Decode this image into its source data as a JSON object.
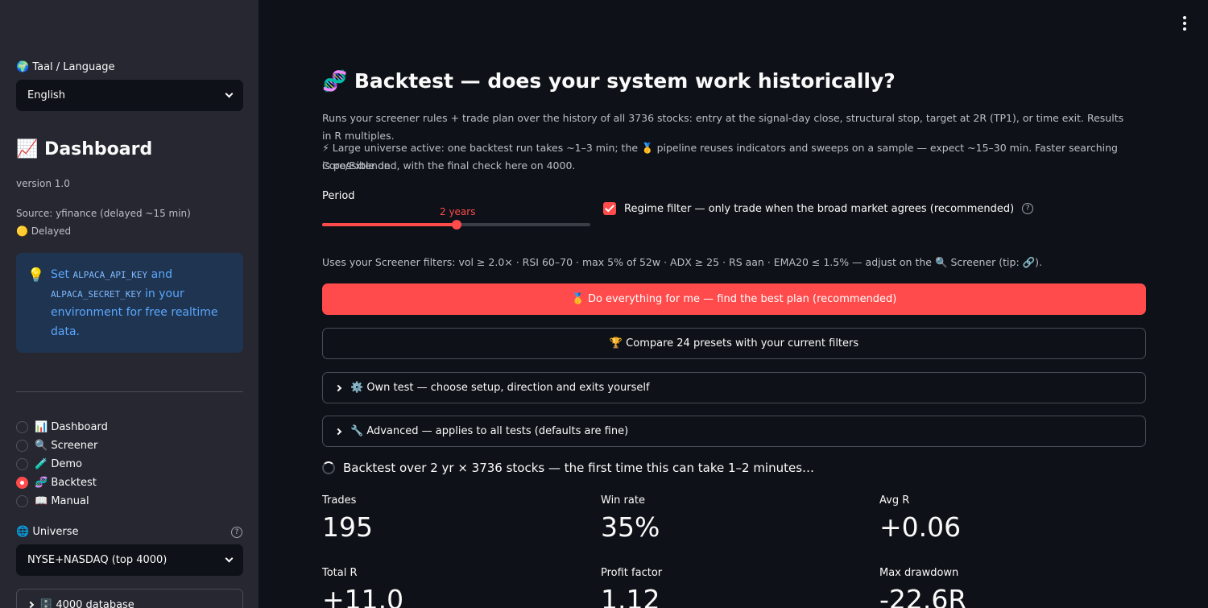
{
  "sidebar": {
    "language_label": "🌍 Taal / Language",
    "language_value": "English",
    "title": "📈 Dashboard",
    "version": "version 1.0",
    "source": "Source: yfinance (delayed ~15 min)",
    "status": "🟡 Delayed",
    "info": {
      "icon": "💡",
      "part1": "Set ",
      "code1": "ALPACA_API_KEY",
      "part2": " and ",
      "code2": "ALPACA_SECRET_KEY",
      "part3": " in your environment for free realtime data."
    },
    "nav": [
      {
        "label": "📊 Dashboard",
        "selected": false
      },
      {
        "label": "🔍 Screener",
        "selected": false
      },
      {
        "label": "🧪 Demo",
        "selected": false
      },
      {
        "label": "🧬 Backtest",
        "selected": true
      },
      {
        "label": "📖 Manual",
        "selected": false
      }
    ],
    "universe_label": "🌐 Universe",
    "universe_value": "NYSE+NASDAQ (top 4000)",
    "database_expander": "🗄️ 4000 database"
  },
  "main": {
    "title": "🧬 Backtest — does your system work historically?",
    "description": "Runs your screener rules + trade plan over the history of all 3736 stocks: entry at the signal-day close, structural stop, target at 2R (TP1), or time exit. Results in R multiples.",
    "notice_line1": "⚡ Large universe active: one backtest run takes ~1–3 min; the 🥇 pipeline reuses indicators and sweeps on a sample — expect ~15–30 min. Faster searching is possible on",
    "notice_line2": "Core/Extended, with the final check here on 4000.",
    "period": {
      "label": "Period",
      "value_label": "2 years",
      "fraction": 0.5
    },
    "regime_filter": {
      "label": "Regime filter — only trade when the broad market agrees (recommended)",
      "checked": true
    },
    "filters_text": "Uses your Screener filters: vol ≥ 2.0× · RSI 60–70 · max 5% of 52w · ADX ≥ 25 · RS aan · EMA20 ≤ 1.5% — adjust on the 🔍 Screener (tip: 🔗).",
    "primary_button": "🥇 Do everything for me — find the best plan (recommended)",
    "secondary_button": "🏆 Compare 24 presets with your current filters",
    "own_test_expander": "⚙️ Own test — choose setup, direction and exits yourself",
    "advanced_expander": "🔧 Advanced — applies to all tests (defaults are fine)",
    "running_text": "Backtest over 2 yr × 3736 stocks — the first time this can take 1–2 minutes…",
    "metrics": [
      {
        "label": "Trades",
        "value": "195"
      },
      {
        "label": "Win rate",
        "value": "35%"
      },
      {
        "label": "Avg R",
        "value": "+0.06"
      },
      {
        "label": "Total R",
        "value": "+11.0"
      },
      {
        "label": "Profit factor",
        "value": "1.12"
      },
      {
        "label": "Max drawdown",
        "value": "-22.6R"
      }
    ]
  }
}
